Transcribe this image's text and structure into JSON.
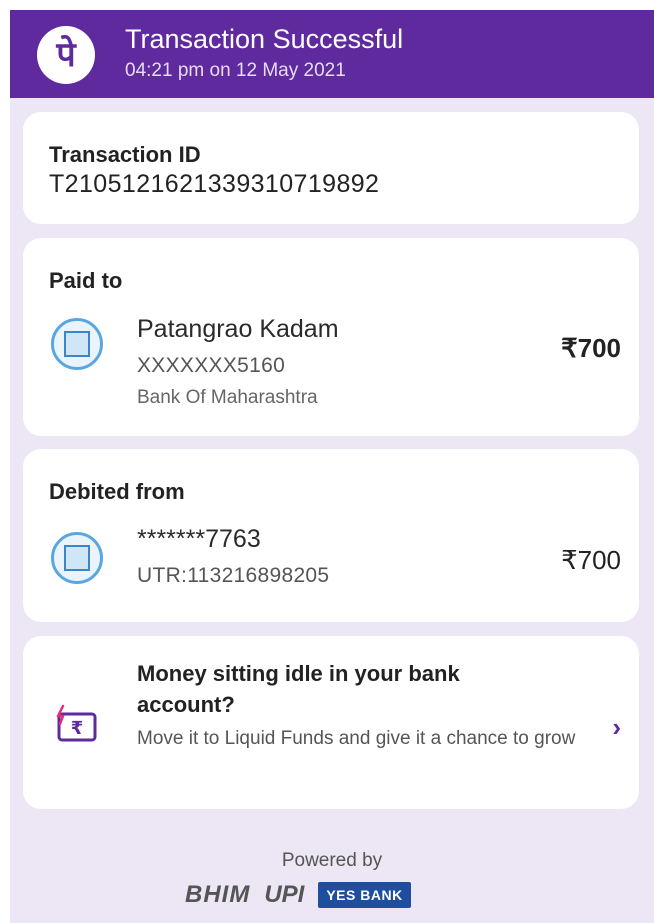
{
  "header": {
    "logo_glyph": "पे",
    "title": "Transaction Successful",
    "time": "04:21 pm on 12 May 2021",
    "color": "#5f2a9e"
  },
  "transaction": {
    "label": "Transaction ID",
    "id": "T2105121621339310719892"
  },
  "paid_to": {
    "label": "Paid to",
    "name": "Patangrao Kadam",
    "account": "XXXXXXX5160",
    "bank": "Bank Of Maharashtra",
    "amount": "₹700",
    "icon": "bank-of-maharashtra-logo"
  },
  "debited_from": {
    "label": "Debited from",
    "account": "*******7763",
    "utr": "UTR:113216898205",
    "amount": "₹700",
    "icon": "bank-of-maharashtra-logo"
  },
  "promo": {
    "title": "Money sitting idle in your bank account?",
    "description": "Move it to Liquid Funds and give it a chance to grow",
    "icon": "rupee-flash-icon",
    "chevron": "›"
  },
  "footer": {
    "powered_by": "Powered by",
    "bhim": "BHIM",
    "upi": "UPI",
    "bank": "YES BANK"
  }
}
